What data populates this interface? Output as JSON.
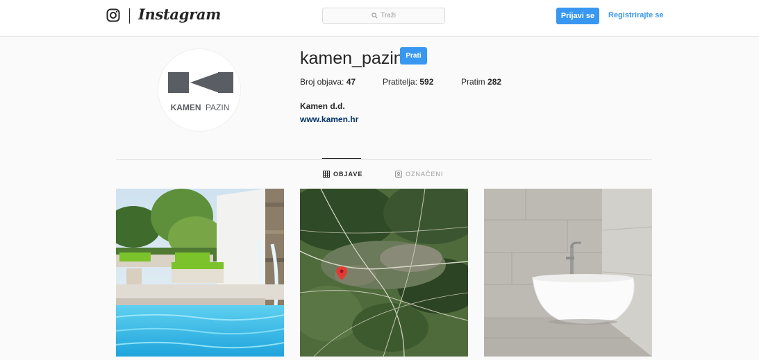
{
  "header": {
    "brand": "Instagram",
    "search_placeholder": "Traži",
    "login_label": "Prijavi se",
    "register_label": "Registrirajte se"
  },
  "profile": {
    "username": "kamen_pazin",
    "follow_label": "Prati",
    "stats": {
      "posts_label": "Broj objava:",
      "posts_value": "47",
      "followers_label": "Pratitelja:",
      "followers_value": "592",
      "following_label": "Pratim",
      "following_value": "282"
    },
    "full_name": "Kamen d.d.",
    "website": "www.kamen.hr",
    "avatar_logo": {
      "brand_bold": "KAMEN",
      "brand_light": "PAZIN"
    }
  },
  "tabs": {
    "posts": "OBJAVE",
    "tagged": "OZNAČENI",
    "active": "posts"
  },
  "posts": [
    {
      "subject": "pool-terrace-photo"
    },
    {
      "subject": "satellite-map-photo"
    },
    {
      "subject": "stone-bathtub-photo"
    }
  ],
  "colors": {
    "accent": "#3897f0",
    "link": "#003569",
    "background": "#fafafa",
    "logo_gray": "#5a5d63"
  }
}
